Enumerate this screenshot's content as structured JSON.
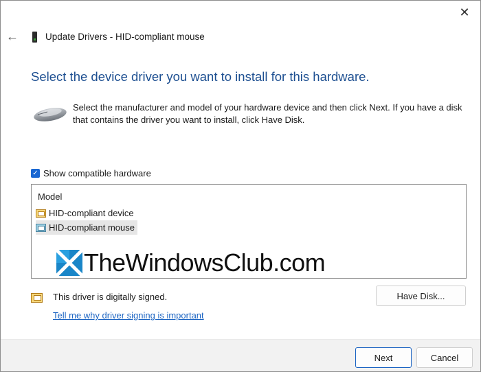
{
  "window": {
    "title": "Update Drivers - HID-compliant mouse",
    "close_glyph": "✕",
    "back_glyph": "←"
  },
  "main": {
    "heading": "Select the device driver you want to install for this hardware.",
    "description": "Select the manufacturer and model of your hardware device and then click Next. If you have a disk that contains the driver you want to install, click Have Disk."
  },
  "compatible": {
    "label": "Show compatible hardware",
    "checked": true
  },
  "model_list": {
    "header": "Model",
    "items": [
      {
        "label": "HID-compliant device",
        "selected": false,
        "icon": "driver-package-icon"
      },
      {
        "label": "HID-compliant mouse",
        "selected": true,
        "icon": "driver-package-icon"
      }
    ]
  },
  "watermark": {
    "text": "TheWindowsClub.com"
  },
  "signing": {
    "status": "This driver is digitally signed.",
    "link": "Tell me why driver signing is important"
  },
  "buttons": {
    "have_disk": "Have Disk...",
    "next": "Next",
    "cancel": "Cancel"
  },
  "colors": {
    "heading": "#1d4f91",
    "link": "#1a63c2",
    "checkbox": "#1967d2",
    "footer_bg": "#f2f2f2"
  }
}
